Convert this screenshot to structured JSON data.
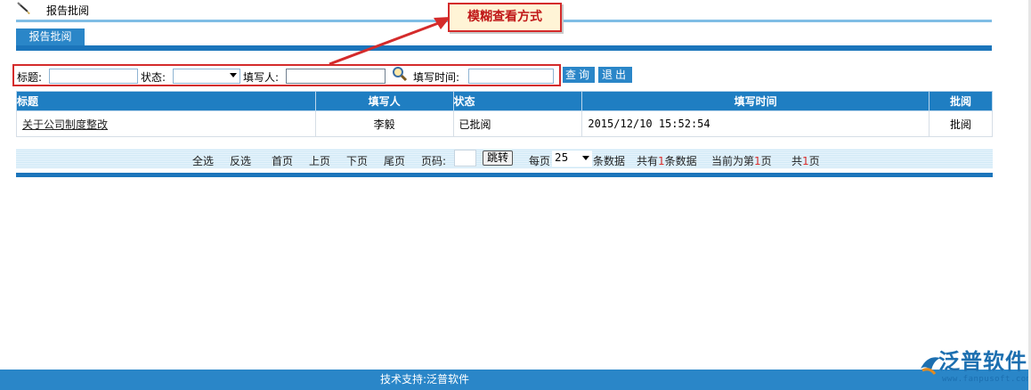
{
  "header": {
    "title": "报告批阅"
  },
  "tab": {
    "label": "报告批阅"
  },
  "callout": {
    "text": "模糊查看方式"
  },
  "search": {
    "title_label": "标题:",
    "title_value": "",
    "status_label": "状态:",
    "status_value": "",
    "person_label": "填写人:",
    "person_value": "",
    "time_label": "填写时间:",
    "time_value": "",
    "query_button": "查询",
    "exit_button": "退出"
  },
  "table": {
    "headers": [
      "标题",
      "填写人",
      "状态",
      "填写时间",
      "批阅"
    ],
    "rows": [
      {
        "title": "关于公司制度整改",
        "person": "李毅",
        "status": "已批阅",
        "time": "2015/12/10 15:52:54",
        "review": "批阅"
      }
    ]
  },
  "pager": {
    "select_all": "全选",
    "invert": "反选",
    "first": "首页",
    "prev": "上页",
    "next": "下页",
    "last": "尾页",
    "page_label": "页码:",
    "jump": "跳转",
    "per_page_label": "每页",
    "per_page_value": "25",
    "per_page_suffix": "条数据",
    "total_prefix": "共有",
    "total_count": "1",
    "total_suffix": "条数据",
    "current_prefix": "当前为第",
    "current_page": "1",
    "current_suffix": "页",
    "pages_prefix": "共",
    "pages_count": "1",
    "pages_suffix": "页"
  },
  "footer": {
    "text": "技术支持:泛普软件"
  },
  "logo": {
    "name": "泛普软件",
    "url": "www.fanpusoft.com"
  },
  "colors": {
    "accent": "#2a86c8",
    "header_blue": "#1f7ec2",
    "callout_red": "#d42b2b"
  }
}
